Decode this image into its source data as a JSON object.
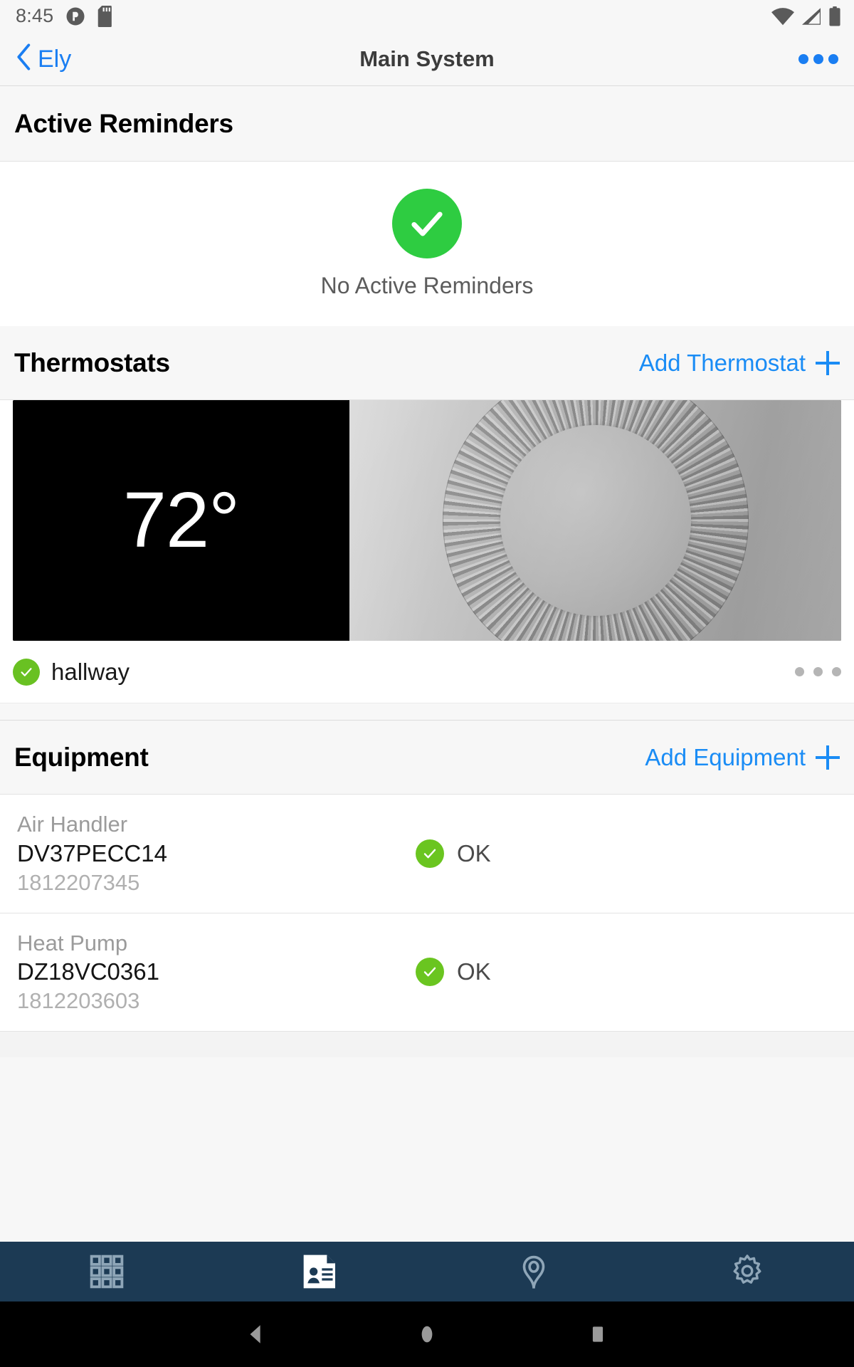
{
  "status_bar": {
    "time": "8:45",
    "left_icons": [
      "do-not-disturb-icon",
      "sd-card-icon"
    ],
    "right_icons": [
      "wifi-icon",
      "cellular-signal-icon",
      "battery-icon"
    ]
  },
  "navbar": {
    "back_label": "Ely",
    "back_icon": "chevron-left-icon",
    "title": "Main System",
    "overflow_icon": "more-options-icon"
  },
  "reminders": {
    "title": "Active Reminders",
    "empty_text": "No Active Reminders",
    "status_icon": "check-circle-icon",
    "status_color": "#2ecc41"
  },
  "thermostats": {
    "title": "Thermostats",
    "action_label": "Add Thermostat",
    "action_icon": "plus-icon",
    "action_color": "#1a8cf5",
    "cards": [
      {
        "temperature": "72°",
        "name": "hallway",
        "status_icon": "check-circle-icon",
        "status_color": "#69c122",
        "overflow_icon": "more-options-icon",
        "image": "thermostat-dial-photo"
      }
    ]
  },
  "equipment": {
    "title": "Equipment",
    "action_label": "Add Equipment",
    "action_icon": "plus-icon",
    "action_color": "#1a8cf5",
    "items": [
      {
        "type": "Air Handler",
        "model": "DV37PECC14",
        "serial": "1812207345",
        "status": "OK",
        "status_icon": "check-circle-icon",
        "status_color": "#6ac520"
      },
      {
        "type": "Heat Pump",
        "model": "DZ18VC0361",
        "serial": "1812203603",
        "status": "OK",
        "status_icon": "check-circle-icon",
        "status_color": "#6ac520"
      }
    ]
  },
  "tabbar": {
    "background": "#1c3a54",
    "tabs": [
      {
        "name": "grid-icon",
        "active": false
      },
      {
        "name": "contact-card-icon",
        "active": true
      },
      {
        "name": "location-pin-icon",
        "active": false
      },
      {
        "name": "gear-icon",
        "active": false
      }
    ]
  },
  "system_nav": {
    "back_icon": "triangle-back-icon",
    "home_icon": "circle-home-icon",
    "recents_icon": "square-recents-icon"
  }
}
